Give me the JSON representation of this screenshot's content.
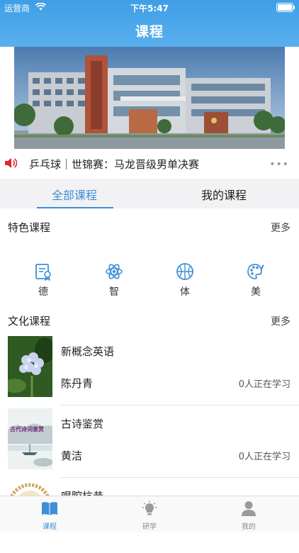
{
  "status_bar": {
    "carrier": "运营商",
    "time": "下午5:47"
  },
  "header": {
    "title": "课程"
  },
  "notice": {
    "text": "乒乓球｜世锦赛：马龙晋级男单决赛",
    "more": "•••"
  },
  "tabs": [
    {
      "label": "全部课程",
      "active": true
    },
    {
      "label": "我的课程",
      "active": false
    }
  ],
  "featured": {
    "title": "特色课程",
    "more": "更多",
    "categories": [
      {
        "label": "德",
        "icon": "certificate-icon"
      },
      {
        "label": "智",
        "icon": "atom-icon"
      },
      {
        "label": "体",
        "icon": "basketball-icon"
      },
      {
        "label": "美",
        "icon": "palette-icon"
      }
    ]
  },
  "culture": {
    "title": "文化课程",
    "more": "更多",
    "courses": [
      {
        "name": "新概念英语",
        "teacher": "陈丹青",
        "learners": "0人正在学习",
        "thumb": "hydrangea-photo"
      },
      {
        "name": "古诗鉴赏",
        "teacher": "黄洁",
        "learners": "0人正在学习",
        "thumb": "ancient-poetry-painting",
        "thumb_text": "古代诗词鉴赏"
      },
      {
        "name": "唱腔杭昔",
        "thumb": "ornament-photo"
      }
    ]
  },
  "tabbar": [
    {
      "label": "课程",
      "icon": "book-icon",
      "active": true
    },
    {
      "label": "研学",
      "icon": "lightbulb-icon",
      "active": false
    },
    {
      "label": "我的",
      "icon": "user-icon",
      "active": false
    }
  ],
  "colors": {
    "accent": "#3d8fd9",
    "header": "#4aa6ea",
    "speaker": "#e0282e"
  }
}
